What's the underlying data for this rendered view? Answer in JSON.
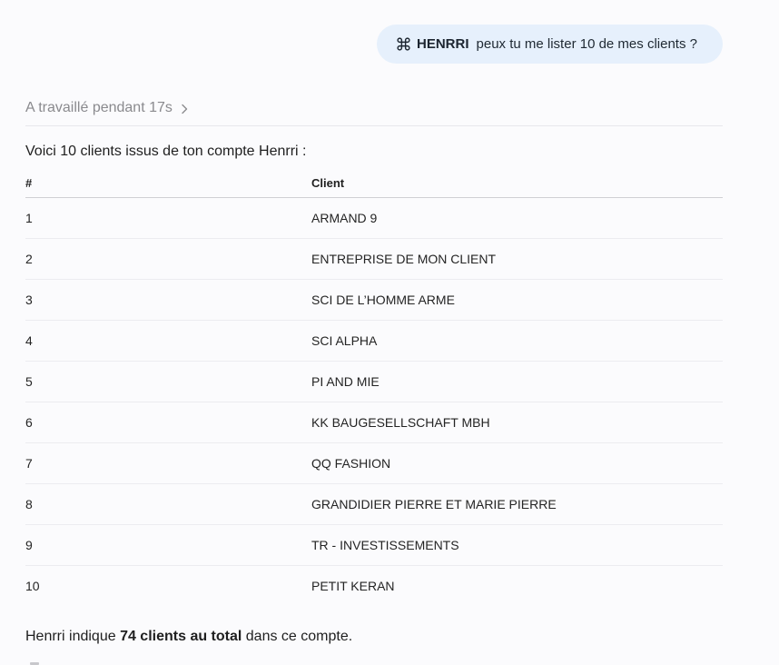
{
  "user_message": {
    "icon": "command-icon",
    "mention": "HENRRI",
    "text": "peux tu me lister 10 de mes clients ?"
  },
  "thinking": {
    "label": "A travaillé pendant 17s",
    "icon": "chevron-right-icon"
  },
  "response": {
    "intro": "Voici 10 clients issus de ton compte Henrri :",
    "table": {
      "headers": [
        "#",
        "Client"
      ],
      "rows": [
        [
          "1",
          "ARMAND 9"
        ],
        [
          "2",
          "ENTREPRISE DE MON CLIENT"
        ],
        [
          "3",
          "SCI DE L’HOMME ARME"
        ],
        [
          "4",
          "SCI ALPHA"
        ],
        [
          "5",
          "PI AND MIE"
        ],
        [
          "6",
          "KK BAUGESELLSCHAFT MBH"
        ],
        [
          "7",
          "QQ FASHION"
        ],
        [
          "8",
          "GRANDIDIER PIERRE ET MARIE PIERRE"
        ],
        [
          "9",
          "TR - INVESTISSEMENTS"
        ],
        [
          "10",
          "PETIT KERAN"
        ]
      ]
    },
    "summary": {
      "prefix": "Henrri indique ",
      "bold": "74 clients au total",
      "suffix": " dans ce compte."
    }
  }
}
